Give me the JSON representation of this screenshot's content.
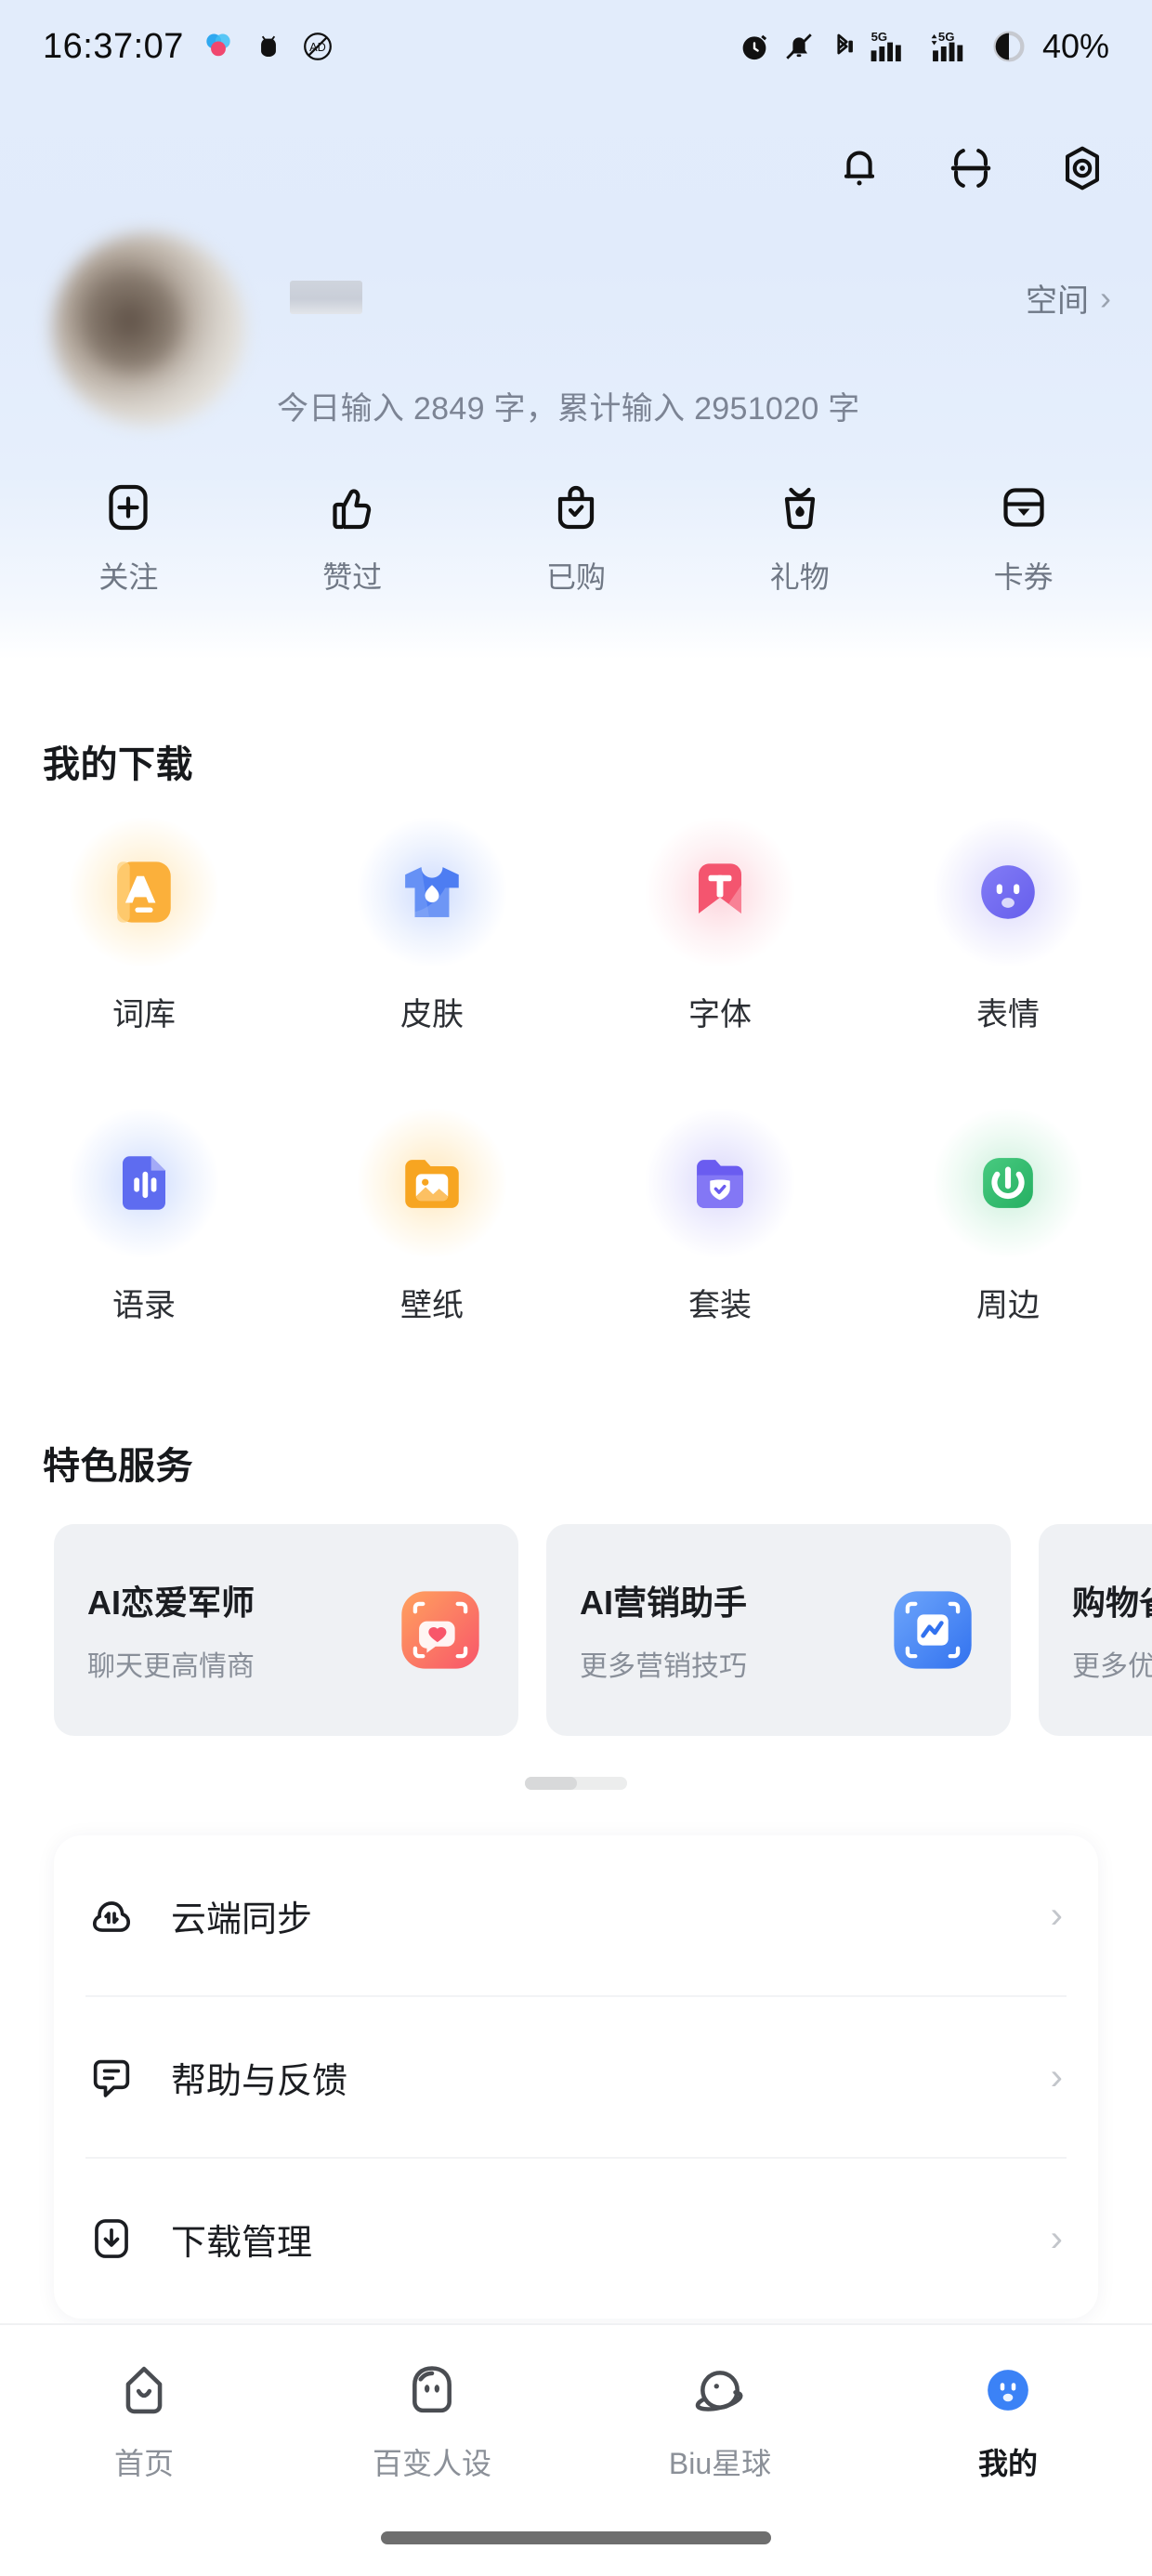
{
  "status_bar": {
    "time": "16:37:07",
    "battery_percent": "40%",
    "left_icons": [
      "cloud-sync-app-icon",
      "bug-icon",
      "ad-block-icon"
    ],
    "right_icons": [
      "alarm-icon",
      "bell-muted-icon",
      "bluetooth-icon",
      "signal-5g-icon",
      "signal-5g-dual-icon",
      "battery-circle-icon"
    ]
  },
  "header": {
    "icons": [
      "bell-icon",
      "scan-icon",
      "settings-icon"
    ],
    "space_label": "空间",
    "username_masked": "···",
    "stats_text": "今日输入 2849 字，累计输入 2951020 字",
    "stats_today_count": "2849",
    "stats_total_count": "2951020"
  },
  "quick_actions": [
    {
      "label": "关注",
      "icon": "plus-box-icon"
    },
    {
      "label": "赞过",
      "icon": "thumbs-up-icon"
    },
    {
      "label": "已购",
      "icon": "purchased-bag-icon"
    },
    {
      "label": "礼物",
      "icon": "gift-cup-icon"
    },
    {
      "label": "卡券",
      "icon": "coupon-card-icon"
    }
  ],
  "downloads": {
    "title": "我的下载",
    "items": [
      {
        "label": "词库",
        "icon": "dictionary-icon",
        "color": "#f9a825",
        "glow": "glow-orange"
      },
      {
        "label": "皮肤",
        "icon": "skin-shirt-icon",
        "color": "#3b6ef0",
        "glow": "glow-blue"
      },
      {
        "label": "字体",
        "icon": "font-bookmark-icon",
        "color": "#f2546f",
        "glow": "glow-pink"
      },
      {
        "label": "表情",
        "icon": "emoji-face-icon",
        "color": "#6a63ec",
        "glow": "glow-purple"
      },
      {
        "label": "语录",
        "icon": "quote-doc-icon",
        "color": "#5a6cf0",
        "glow": "glow-blue"
      },
      {
        "label": "壁纸",
        "icon": "wallpaper-folder-icon",
        "color": "#f6a41f",
        "glow": "glow-orange"
      },
      {
        "label": "套装",
        "icon": "suite-folder-icon",
        "color": "#6a5cf0",
        "glow": "glow-purple"
      },
      {
        "label": "周边",
        "icon": "peripheral-power-icon",
        "color": "#2fb969",
        "glow": "glow-green"
      }
    ]
  },
  "services": {
    "title": "特色服务",
    "cards": [
      {
        "title": "AI恋爱军师",
        "subtitle": "聊天更高情商",
        "icon": "ai-love-icon",
        "color": "#fb7155"
      },
      {
        "title": "AI营销助手",
        "subtitle": "更多营销技巧",
        "icon": "ai-marketing-icon",
        "color": "#4a8cf7"
      },
      {
        "title": "购物省",
        "subtitle": "更多优",
        "icon": "shopping-save-icon",
        "color": "#f0b429"
      }
    ]
  },
  "settings_list": [
    {
      "label": "云端同步",
      "icon": "cloud-sync-icon",
      "chevron": "›"
    },
    {
      "label": "帮助与反馈",
      "icon": "help-feedback-icon",
      "chevron": "›"
    },
    {
      "label": "下载管理",
      "icon": "download-manage-icon",
      "chevron": "›"
    }
  ],
  "bottom_nav": {
    "active_index": 3,
    "items": [
      {
        "label": "首页",
        "icon": "home-icon"
      },
      {
        "label": "百变人设",
        "icon": "persona-robot-icon"
      },
      {
        "label": "Biu星球",
        "icon": "planet-icon"
      },
      {
        "label": "我的",
        "icon": "profile-face-icon"
      }
    ]
  },
  "colors": {
    "accent": "#3b82f6",
    "header_gradient_start": "#e2ecfb",
    "header_gradient_end": "#ffffff",
    "card_bg": "#eff1f4",
    "text_primary": "#1b1d21",
    "text_secondary": "#8b9098"
  }
}
